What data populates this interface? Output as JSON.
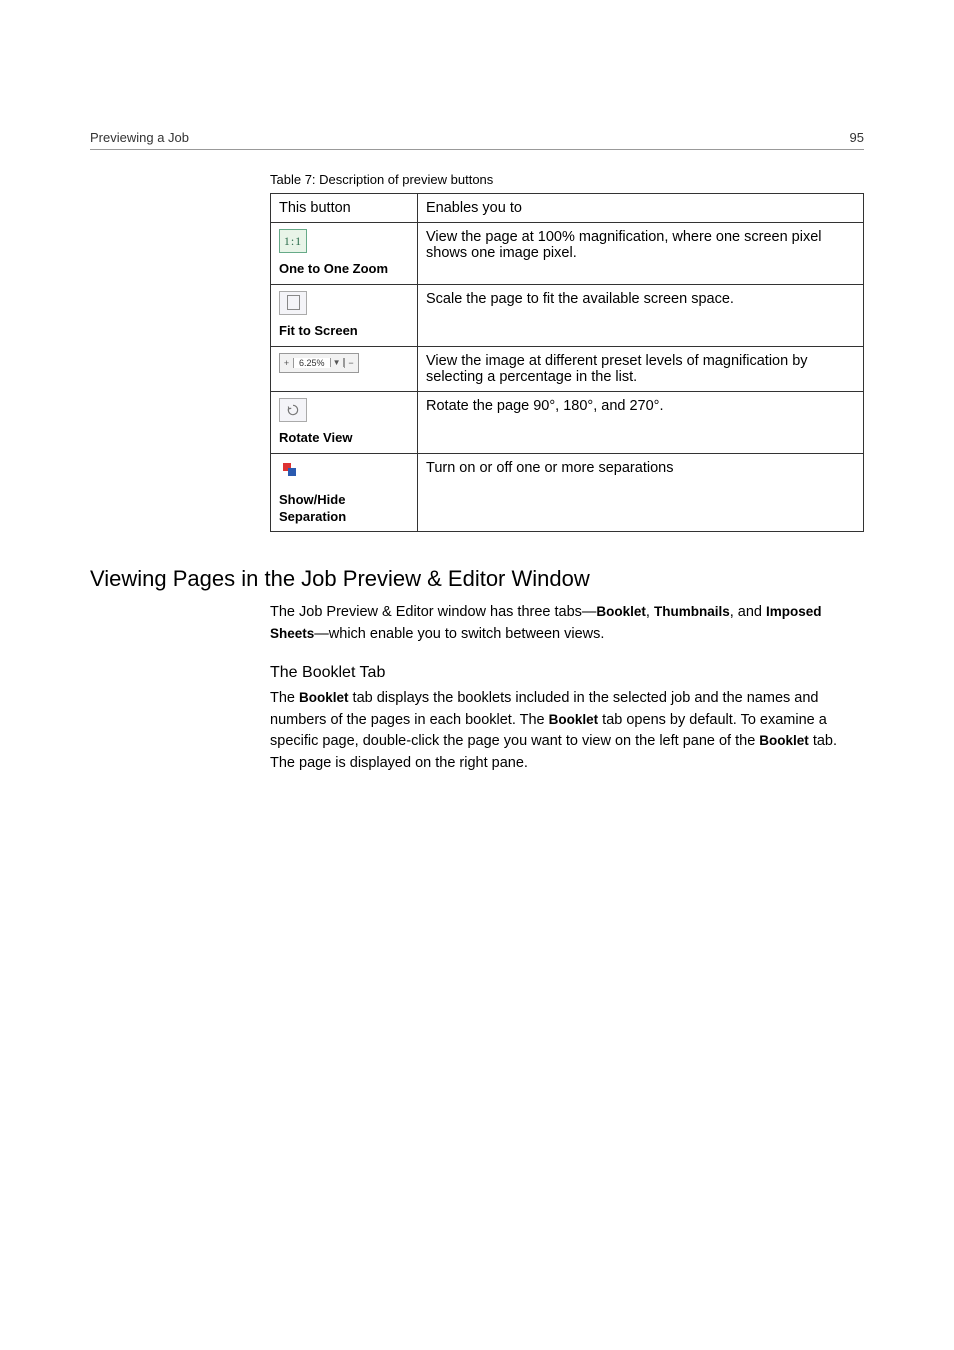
{
  "header": {
    "left": "Previewing a Job",
    "right": "95"
  },
  "table": {
    "caption": "Table 7: Description of preview buttons",
    "head": {
      "c1": "This button",
      "c2": "Enables you to"
    },
    "rows": [
      {
        "icon_text": "1:1",
        "label": "One to One Zoom",
        "desc": "View the page at 100% magnification, where one screen pixel shows one image pixel."
      },
      {
        "label": "Fit to Screen",
        "desc": "Scale the page to fit the available screen space."
      },
      {
        "zoom_value": "6.25%",
        "desc": "View the image at different preset levels of magnification by selecting a percentage in the list."
      },
      {
        "label": "Rotate View",
        "desc": "Rotate the page 90°, 180°, and 270°."
      },
      {
        "label": "Show/Hide Separation",
        "desc": "Turn on or off one or more separations"
      }
    ]
  },
  "section": {
    "title": "Viewing Pages in the Job Preview & Editor Window",
    "intro_pre": "The Job Preview & Editor window has three tabs—",
    "intro_b1": "Booklet",
    "intro_mid1": ", ",
    "intro_b2": "Thumbnails",
    "intro_mid2": ", and ",
    "intro_b3": "Imposed Sheets",
    "intro_post": "—which enable you to switch between views.",
    "subhead": "The Booklet Tab",
    "para2_s1_pre": "The ",
    "para2_b1": "Booklet",
    "para2_s1_post": " tab displays the booklets included in the selected job and the names and numbers of the pages in each booklet. The ",
    "para2_b2": "Booklet",
    "para2_s2": " tab opens by default. To examine a specific page, double-click the page you want to view on the left pane of the ",
    "para2_b3": "Booklet",
    "para2_s3": " tab. The page is displayed on the right pane."
  }
}
